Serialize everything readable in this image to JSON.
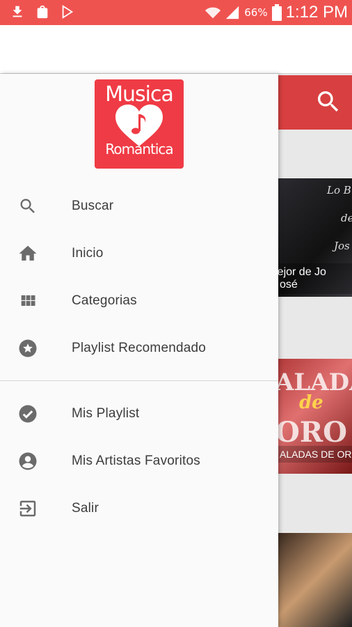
{
  "status_bar": {
    "battery": "66%",
    "time": "1:12 PM",
    "left_icons": [
      "download-icon",
      "shopping-bag-icon",
      "play-store-icon"
    ],
    "right_icons": [
      "wifi-icon",
      "signal-icon",
      "battery-icon"
    ],
    "color": "#ef5350"
  },
  "drawer": {
    "logo": {
      "title": "Musica",
      "subtitle": "Romantica",
      "color": "#ef3b45"
    },
    "primary_items": [
      {
        "label": "Buscar",
        "icon": "search-icon"
      },
      {
        "label": "Inicio",
        "icon": "home-icon"
      },
      {
        "label": "Categorias",
        "icon": "grid-icon"
      },
      {
        "label": "Playlist Recomendado",
        "icon": "star-circle-icon"
      }
    ],
    "secondary_items": [
      {
        "label": "Mis Playlist",
        "icon": "check-circle-icon"
      },
      {
        "label": "Mis Artistas Favoritos",
        "icon": "account-circle-icon"
      },
      {
        "label": "Salir",
        "icon": "exit-icon"
      }
    ]
  },
  "background": {
    "toolbar_color": "#d83f40",
    "cards": [
      {
        "caption_line1": "o Mejor de Jo",
        "caption_line2": "osé",
        "art_text": "Lo Be ... de Jo"
      },
      {
        "caption_line1": "ALADAS DE OR",
        "art_text": "ALADA de ORO"
      },
      {
        "caption_line1": ""
      }
    ]
  }
}
